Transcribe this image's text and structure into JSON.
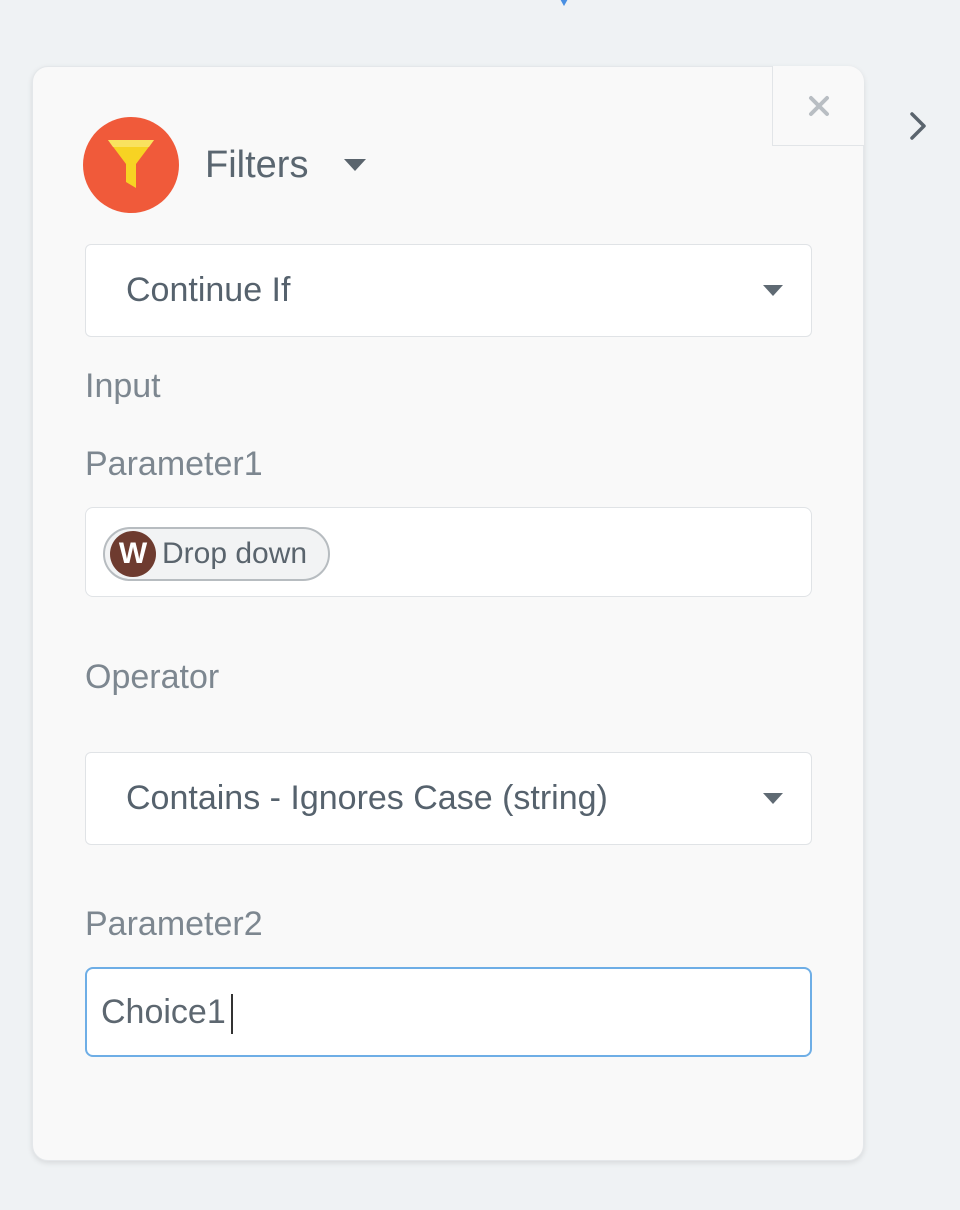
{
  "header": {
    "title": "Filters",
    "logo_icon": "funnel-icon",
    "logo_color": "#f05a3a"
  },
  "action_select": {
    "value": "Continue If"
  },
  "section": {
    "input_label": "Input"
  },
  "parameter1": {
    "label": "Parameter1",
    "token": {
      "avatar_letter": "W",
      "label": "Drop down"
    }
  },
  "operator": {
    "label": "Operator",
    "value": "Contains - Ignores Case (string)"
  },
  "parameter2": {
    "label": "Parameter2",
    "value": "Choice1"
  },
  "colors": {
    "accent_focus": "#6eaee6",
    "background": "#eff2f4",
    "panel": "#f9f9f9"
  }
}
